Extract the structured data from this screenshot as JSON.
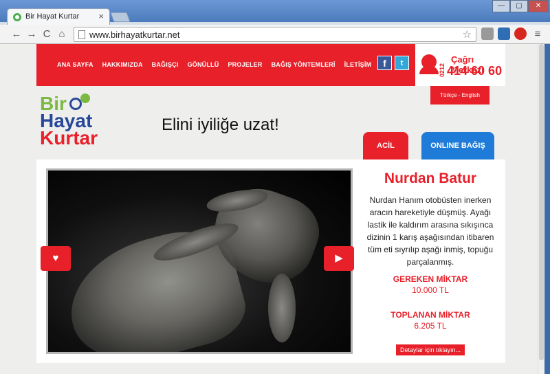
{
  "browser": {
    "tab_title": "Bir Hayat Kurtar",
    "tab_close": "×",
    "url": "www.birhayatkurtar.net",
    "back": "←",
    "forward": "→",
    "reload": "C",
    "home": "⌂",
    "star": "☆",
    "menu": "≡",
    "min": "—",
    "max": "▢",
    "close": "✕"
  },
  "nav": {
    "items": [
      "ANA SAYFA",
      "HAKKIMIZDA",
      "BAĞIŞÇI",
      "GÖNÜLLÜ",
      "PROJELER",
      "BAĞIŞ YÖNTEMLERİ",
      "İLETİŞİM"
    ],
    "facebook": "f",
    "twitter": "t"
  },
  "call": {
    "area": "0212",
    "title": "Çağrı Merkezi",
    "number": "414 60 60"
  },
  "language": "Türkçe - English",
  "logo": {
    "line1": "Bir",
    "line2": "Hayat",
    "line3": "Kurtar"
  },
  "slogan": "Elini iyiliğe uzat!",
  "tabs": {
    "acil": "ACİL",
    "online": "ONLINE BAĞIŞ"
  },
  "slider": {
    "prev": "♥",
    "next": "▶"
  },
  "case": {
    "name": "Nurdan Batur",
    "story": "Nurdan Hanım otobüsten inerken aracın hareketiyle düşmüş. Ayağı lastik ile kaldırım arasına sıkışınca dizinin 1 karış aşağısından itibaren tüm eti sıyrılıp aşağı inmiş, topuğu parçalanmış.",
    "required_label": "GEREKEN MİKTAR",
    "required_amount": "10.000 TL",
    "collected_label": "TOPLANAN MİKTAR",
    "collected_amount": "6.205 TL",
    "details_button": "Detaylar için tıklayın..."
  },
  "colors": {
    "brand_red": "#e8202a",
    "brand_blue": "#1e7bd8",
    "logo_green": "#7bb943",
    "logo_navy": "#27489a"
  }
}
